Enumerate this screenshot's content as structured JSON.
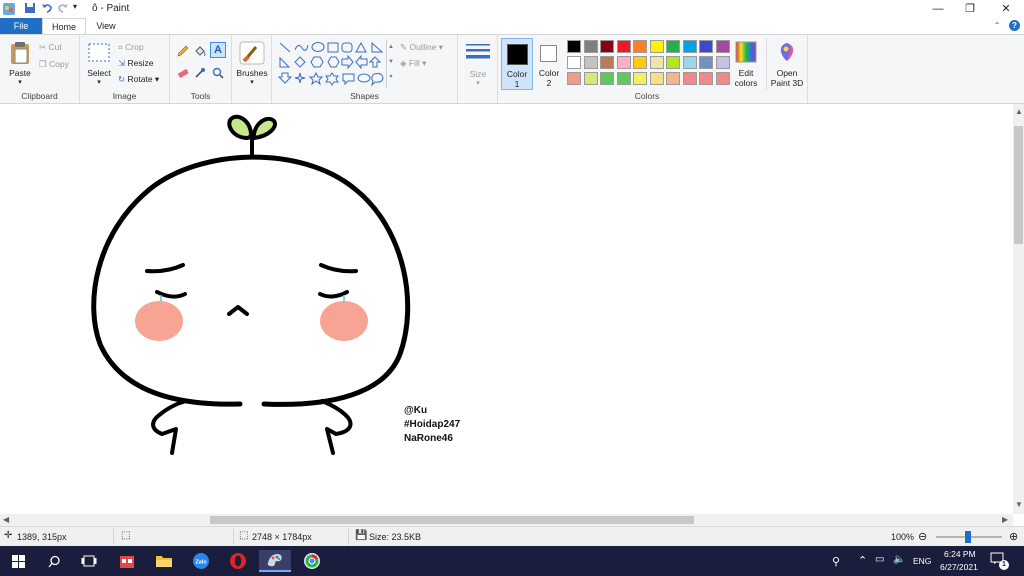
{
  "window": {
    "title": "ô - Paint",
    "minimize_icon": "minimize-icon",
    "restore_icon": "restore-icon",
    "close_icon": "close-icon"
  },
  "tabs": [
    {
      "label": "File"
    },
    {
      "label": "Home"
    },
    {
      "label": "View"
    }
  ],
  "ribbon": {
    "clipboard": {
      "label": "Clipboard",
      "paste": "Paste",
      "cut": "Cut",
      "copy": "Copy"
    },
    "image": {
      "label": "Image",
      "select": "Select",
      "crop": "Crop",
      "resize": "Resize",
      "rotate": "Rotate"
    },
    "tools": {
      "label": "Tools"
    },
    "brushes": {
      "label": "Brushes"
    },
    "shapes": {
      "label": "Shapes",
      "outline": "Outline",
      "fill": "Fill"
    },
    "size": {
      "label": "Size"
    },
    "color1": {
      "label": "Color",
      "num": "1",
      "value": "#000000"
    },
    "color2": {
      "label": "Color",
      "num": "2",
      "value": "#ffffff"
    },
    "colors": {
      "label": "Colors",
      "palette": [
        [
          "#000000",
          "#7f7f7f",
          "#880015",
          "#ed1c24",
          "#ff7f27",
          "#fff200",
          "#22b14c",
          "#00a2e8",
          "#3f48cc",
          "#a349a4"
        ],
        [
          "#ffffff",
          "#c3c3c3",
          "#b97a57",
          "#ffaec9",
          "#ffc90e",
          "#efe4b0",
          "#b5e61d",
          "#99d9ea",
          "#7092be",
          "#c8bfe7"
        ],
        [
          "#f29a8a",
          "#d6e87a",
          "#5bc95b",
          "#63c95e",
          "#f3ef62",
          "#f6df8a",
          "#f5b58a",
          "#f08a8a",
          "#f08a8a",
          "#f08a8a"
        ]
      ]
    },
    "edit_colors": {
      "line1": "Edit",
      "line2": "colors"
    },
    "paint3d": {
      "line1": "Open",
      "line2": "Paint 3D"
    }
  },
  "canvas": {
    "signature": [
      "@Ku",
      "#Hoidap247",
      "NaRone46"
    ],
    "colors": {
      "outline": "#000000",
      "sprout": "#c8e68a",
      "blush": "#f7a494",
      "tear": "#7fd3e8"
    }
  },
  "statusbar": {
    "cursor_pos": "1389, 315px",
    "image_size": "2748 × 1784px",
    "file_size": "Size: 23.5KB",
    "zoom": "100%"
  },
  "taskbar": {
    "language": "ENG",
    "time": "6:24 PM",
    "date": "6/27/2021",
    "notification_count": "1"
  }
}
